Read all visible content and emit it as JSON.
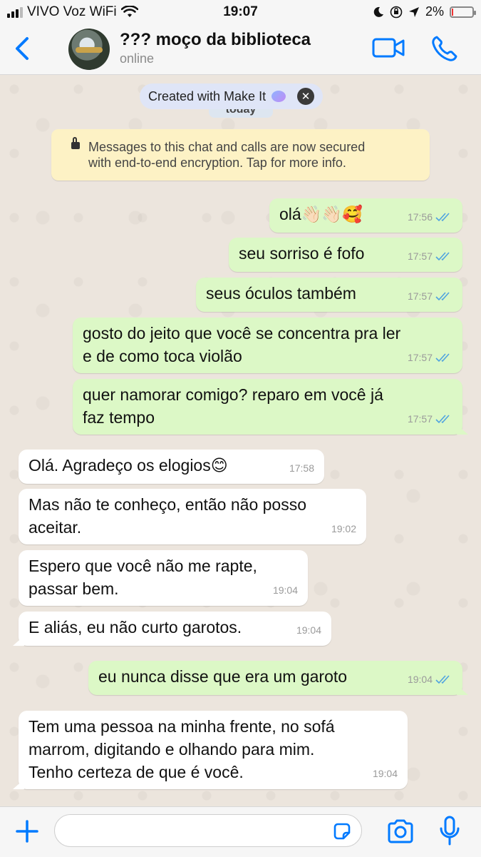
{
  "status_bar": {
    "carrier": "VIVO Voz WiFi",
    "time": "19:07",
    "battery": "2%",
    "battery_level": 0.02
  },
  "header": {
    "contact_name": "??? moço da biblioteca",
    "status": "online",
    "icons": [
      "back-chevron-icon",
      "video-call-icon",
      "phone-icon"
    ],
    "accent_color": "#007aff"
  },
  "banner": {
    "label": "Created with Make It",
    "date_label": "today"
  },
  "notice": {
    "text": "Messages to this chat and calls are now secured\nwith end-to-end encryption. Tap for more info."
  },
  "messages": [
    {
      "dir": "out",
      "text": "olá👋🏻👋🏻🥰",
      "time": "17:56",
      "read": true
    },
    {
      "dir": "out",
      "text": "seu sorriso é fofo",
      "time": "17:57",
      "read": true
    },
    {
      "dir": "out",
      "text": "seus óculos também",
      "time": "17:57",
      "read": true
    },
    {
      "dir": "out",
      "text": "gosto do jeito que você se concentra pra ler\ne de como toca violão",
      "time": "17:57",
      "read": true
    },
    {
      "dir": "out",
      "text": "quer namorar comigo? reparo em você já\nfaz tempo",
      "time": "17:57",
      "read": true
    },
    {
      "dir": "in",
      "text": "Olá. Agradeço os elogios😊",
      "time": "17:58"
    },
    {
      "dir": "in",
      "text": "Mas não te conheço, então não posso\naceitar.",
      "time": "19:02"
    },
    {
      "dir": "in",
      "text": "Espero que você não me rapte,\npassar bem.",
      "time": "19:04"
    },
    {
      "dir": "in",
      "text": "E aliás, eu não curto garotos.",
      "time": "19:04"
    },
    {
      "dir": "out",
      "text": "eu nunca disse que era um garoto",
      "time": "19:04",
      "read": true
    },
    {
      "dir": "in",
      "text": "Tem uma pessoa na minha frente, no sofá\nmarrom, digitando e olhando para mim.\nTenho certeza de que é você.",
      "time": "19:04"
    }
  ],
  "input": {
    "value": "",
    "icons": [
      "plus-icon",
      "sticker-icon",
      "camera-icon",
      "microphone-icon"
    ]
  },
  "colors": {
    "outgoing_bubble": "#dcf8c6",
    "incoming_bubble": "#ffffff",
    "read_ticks": "#4fa3e0",
    "chat_background": "#ece5dd"
  }
}
